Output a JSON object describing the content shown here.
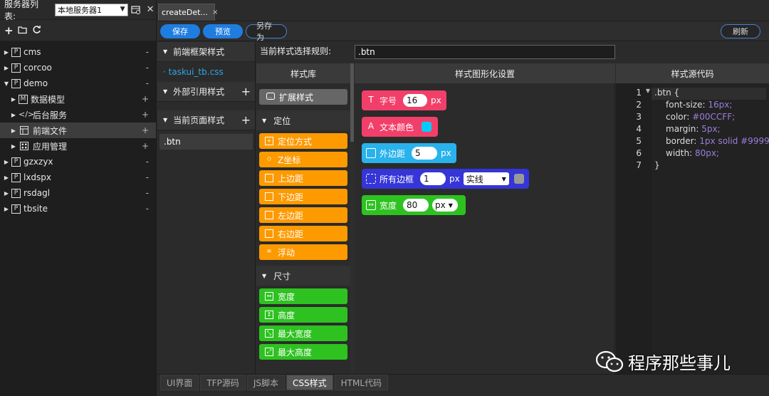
{
  "server_panel": {
    "label": "服务器列表:",
    "selected_server": "本地服务器1",
    "tree": [
      {
        "label": "cms",
        "expanded": false,
        "icon": "P",
        "action": "-"
      },
      {
        "label": "corcoo",
        "expanded": false,
        "icon": "P",
        "action": "-"
      },
      {
        "label": "demo",
        "expanded": true,
        "icon": "P",
        "action": "-"
      },
      {
        "label": "数据模型",
        "icon": "M",
        "action": "+"
      },
      {
        "label": "后台服务",
        "icon": "</>",
        "action": "+"
      },
      {
        "label": "前端文件",
        "icon": "layout",
        "action": "+",
        "selected": true
      },
      {
        "label": "应用管理",
        "icon": "grid",
        "action": "+"
      },
      {
        "label": "gzxzyx",
        "icon": "P",
        "action": "-"
      },
      {
        "label": "lxdspx",
        "icon": "P",
        "action": "-"
      },
      {
        "label": "rsdagl",
        "icon": "P",
        "action": "-"
      },
      {
        "label": "tbsite",
        "icon": "P",
        "action": "-"
      }
    ]
  },
  "doc_tab": {
    "label": "createDet...",
    "close": "×"
  },
  "toolbar": {
    "save": "保存",
    "preview": "预览",
    "save_as": "另存为",
    "refresh": "刷新"
  },
  "styles_panel": {
    "framework_title": "前端框架样式",
    "framework_file": "· taskui_tb.css",
    "external_title": "外部引用样式",
    "current_title": "当前页面样式",
    "current_item": ".btn",
    "plus": "+"
  },
  "rule": {
    "label": "当前样式选择规则:",
    "value": ".btn"
  },
  "library": {
    "title": "样式库",
    "extend": "扩展样式",
    "sections": [
      {
        "title": "定位",
        "color": "orange",
        "items": [
          "定位方式",
          "Z坐标",
          "上边距",
          "下边距",
          "左边距",
          "右边距",
          "浮动"
        ]
      },
      {
        "title": "尺寸",
        "color": "green",
        "items": [
          "宽度",
          "高度",
          "最大宽度",
          "最大高度"
        ]
      }
    ]
  },
  "graphic": {
    "title": "样式图形化设置",
    "font_size": {
      "label": "字号",
      "value": "16",
      "unit": "px",
      "color": "#f23f6a"
    },
    "text_color": {
      "label": "文本颜色",
      "swatch": "#00ccff",
      "color": "#f23f6a"
    },
    "margin": {
      "label": "外边距",
      "value": "5",
      "unit": "px",
      "color": "#29b2ec"
    },
    "border": {
      "label": "所有边框",
      "value": "1",
      "unit": "px",
      "style": "实线",
      "swatch": "#999999",
      "color": "#3535d8"
    },
    "width": {
      "label": "宽度",
      "value": "80",
      "unit": "px",
      "color": "#2ec221"
    }
  },
  "source": {
    "title": "样式源代码",
    "lines": [
      {
        "n": "1",
        "selector": ".btn {"
      },
      {
        "n": "2",
        "prop": "font-size:",
        "val": " 16px;"
      },
      {
        "n": "3",
        "prop": "color:",
        "val": " #00CCFF;"
      },
      {
        "n": "4",
        "prop": "margin:",
        "val": " 5px;"
      },
      {
        "n": "5",
        "prop": "border:",
        "val": " 1px solid #9999"
      },
      {
        "n": "6",
        "prop": "width:",
        "val": " 80px;"
      },
      {
        "n": "7",
        "selector": "}"
      }
    ]
  },
  "bottom_tabs": [
    "UI界面",
    "TFP源码",
    "JS脚本",
    "CSS样式",
    "HTML代码"
  ],
  "active_bottom_tab": "CSS样式",
  "watermark": "程序那些事儿"
}
